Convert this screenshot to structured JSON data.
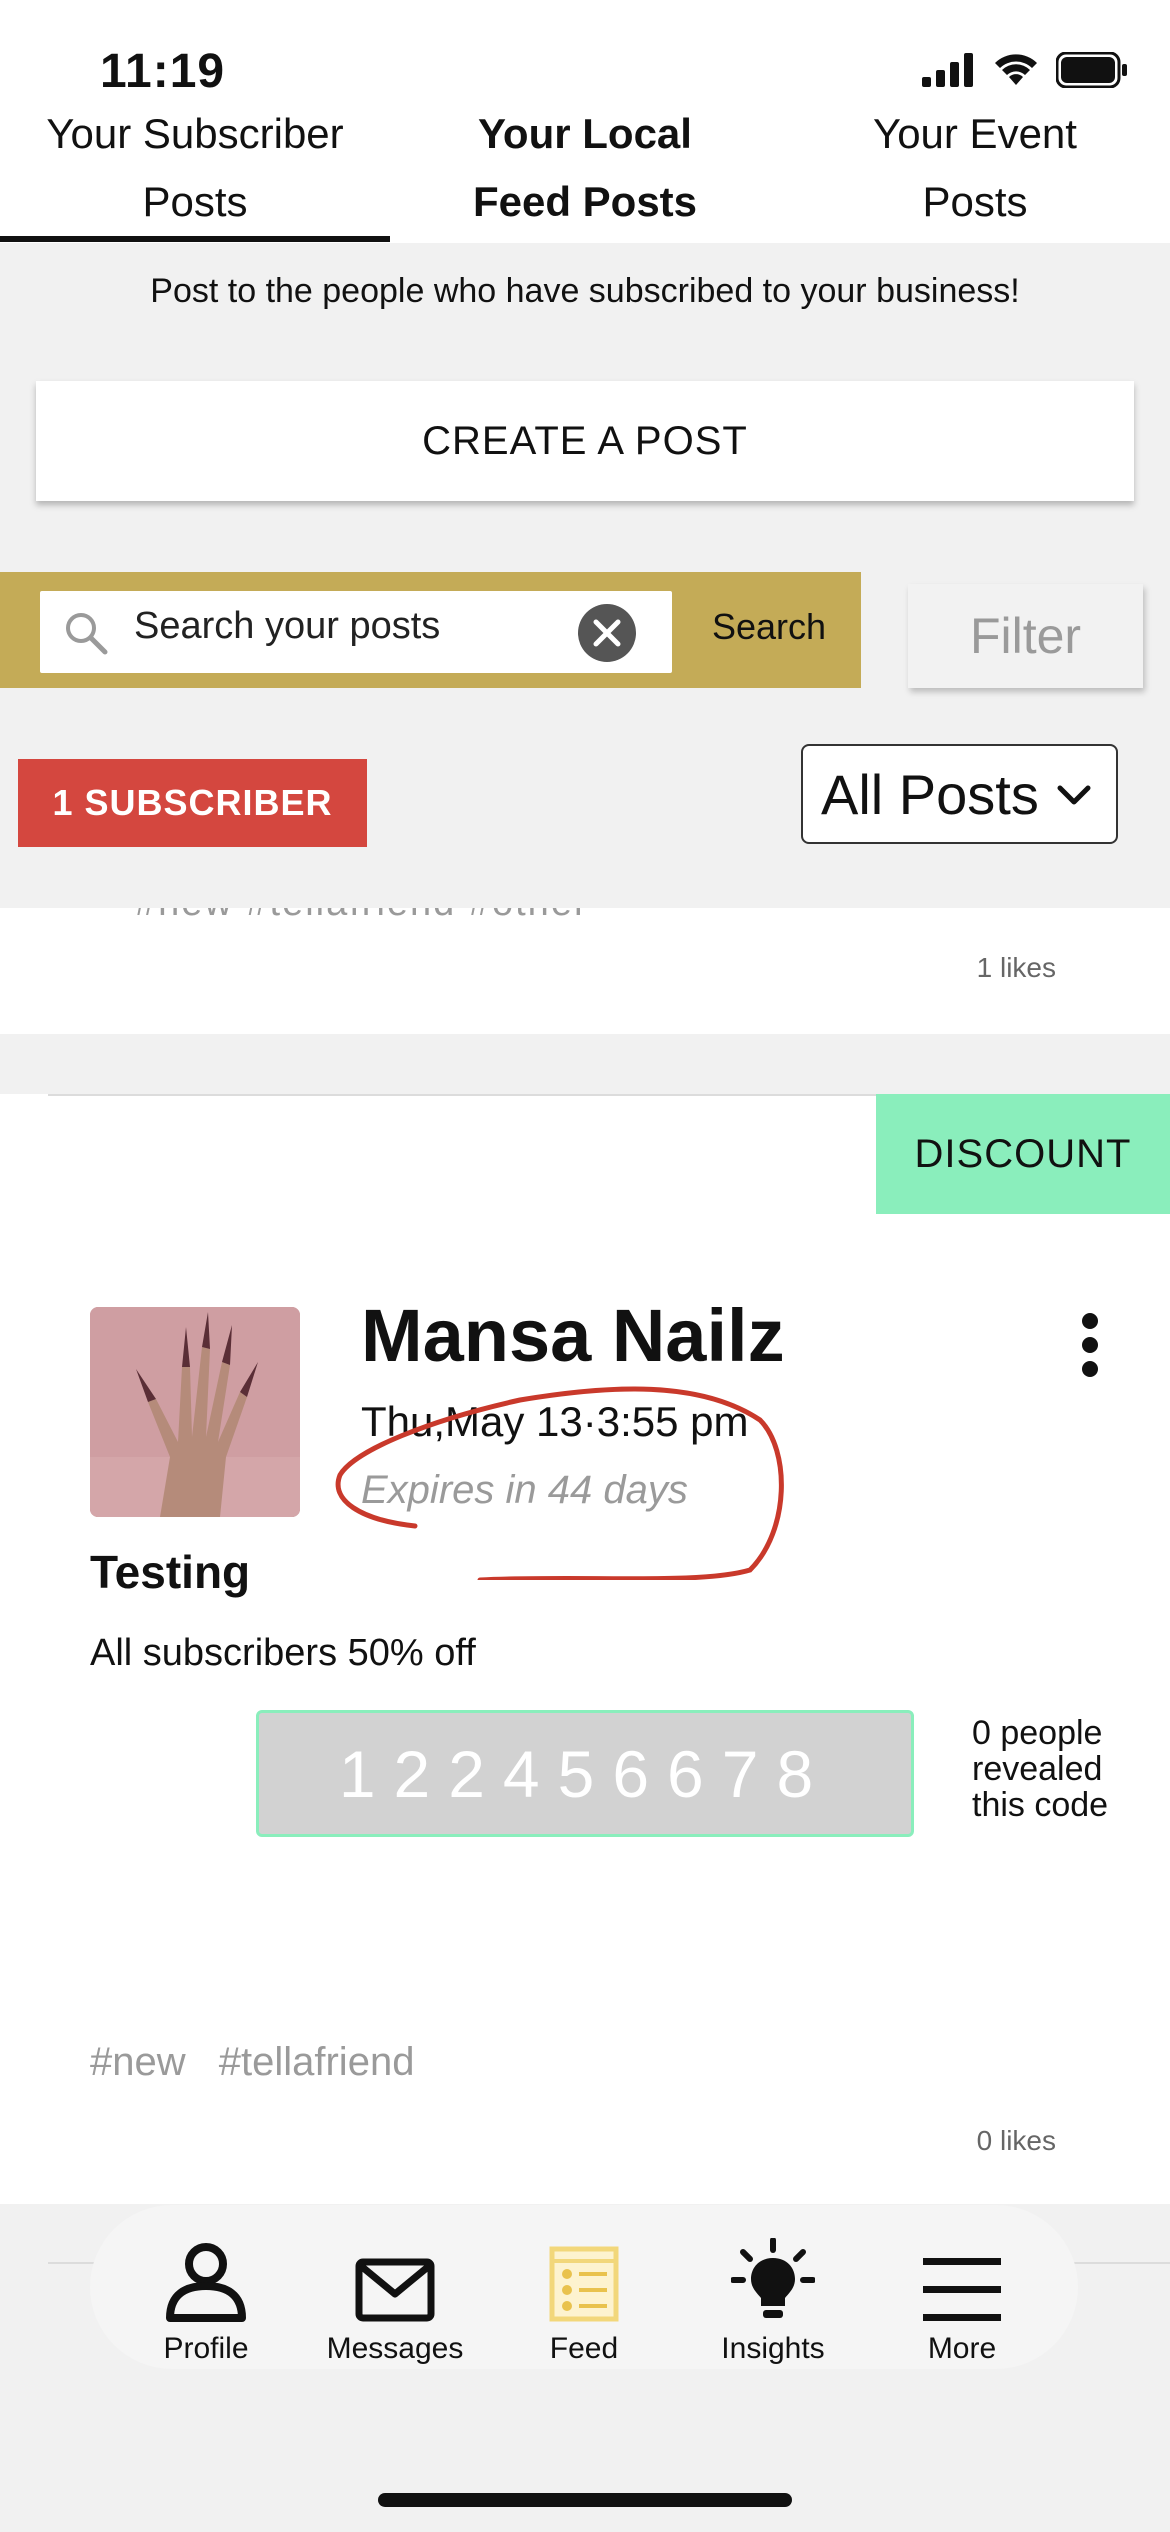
{
  "status_bar": {
    "time": "11:19"
  },
  "tabs": [
    {
      "line1": "Your Subscriber",
      "line2": "Posts"
    },
    {
      "line1": "Your Local",
      "line2": "Feed Posts"
    },
    {
      "line1": "Your Event",
      "line2": "Posts"
    }
  ],
  "info_text": "Post to the people who have subscribed to your business!",
  "create_button": "CREATE A POST",
  "search": {
    "placeholder": "Search your posts",
    "button": "Search",
    "filter": "Filter"
  },
  "subscriber_badge": "1 SUBSCRIBER",
  "posts_filter": {
    "selected": "All Posts"
  },
  "posts": [
    {
      "likes": "1 likes",
      "cut_tags": "#new #tellafriend #other"
    },
    {
      "badge": "DISCOUNT",
      "business": "Mansa Nailz",
      "date": "Thu,May 13·3:55 pm",
      "expires": "Expires in 44 days",
      "title": "Testing",
      "body": "All subscribers 50% off",
      "code": "122456678",
      "revealed": "0 people revealed this code",
      "tags": [
        "#new",
        "#tellafriend"
      ],
      "likes": "0 likes"
    }
  ],
  "nav": [
    {
      "label": "Profile",
      "icon": "person-icon"
    },
    {
      "label": "Messages",
      "icon": "envelope-icon"
    },
    {
      "label": "Feed",
      "icon": "feed-icon"
    },
    {
      "label": "Insights",
      "icon": "lightbulb-icon"
    },
    {
      "label": "More",
      "icon": "menu-icon"
    }
  ],
  "colors": {
    "search_bar": "#c4ab57",
    "badge_red": "#d4473f",
    "discount_green": "#8aeebc",
    "annotation_red": "#c9392b",
    "feed_active": "#f2d77a"
  }
}
